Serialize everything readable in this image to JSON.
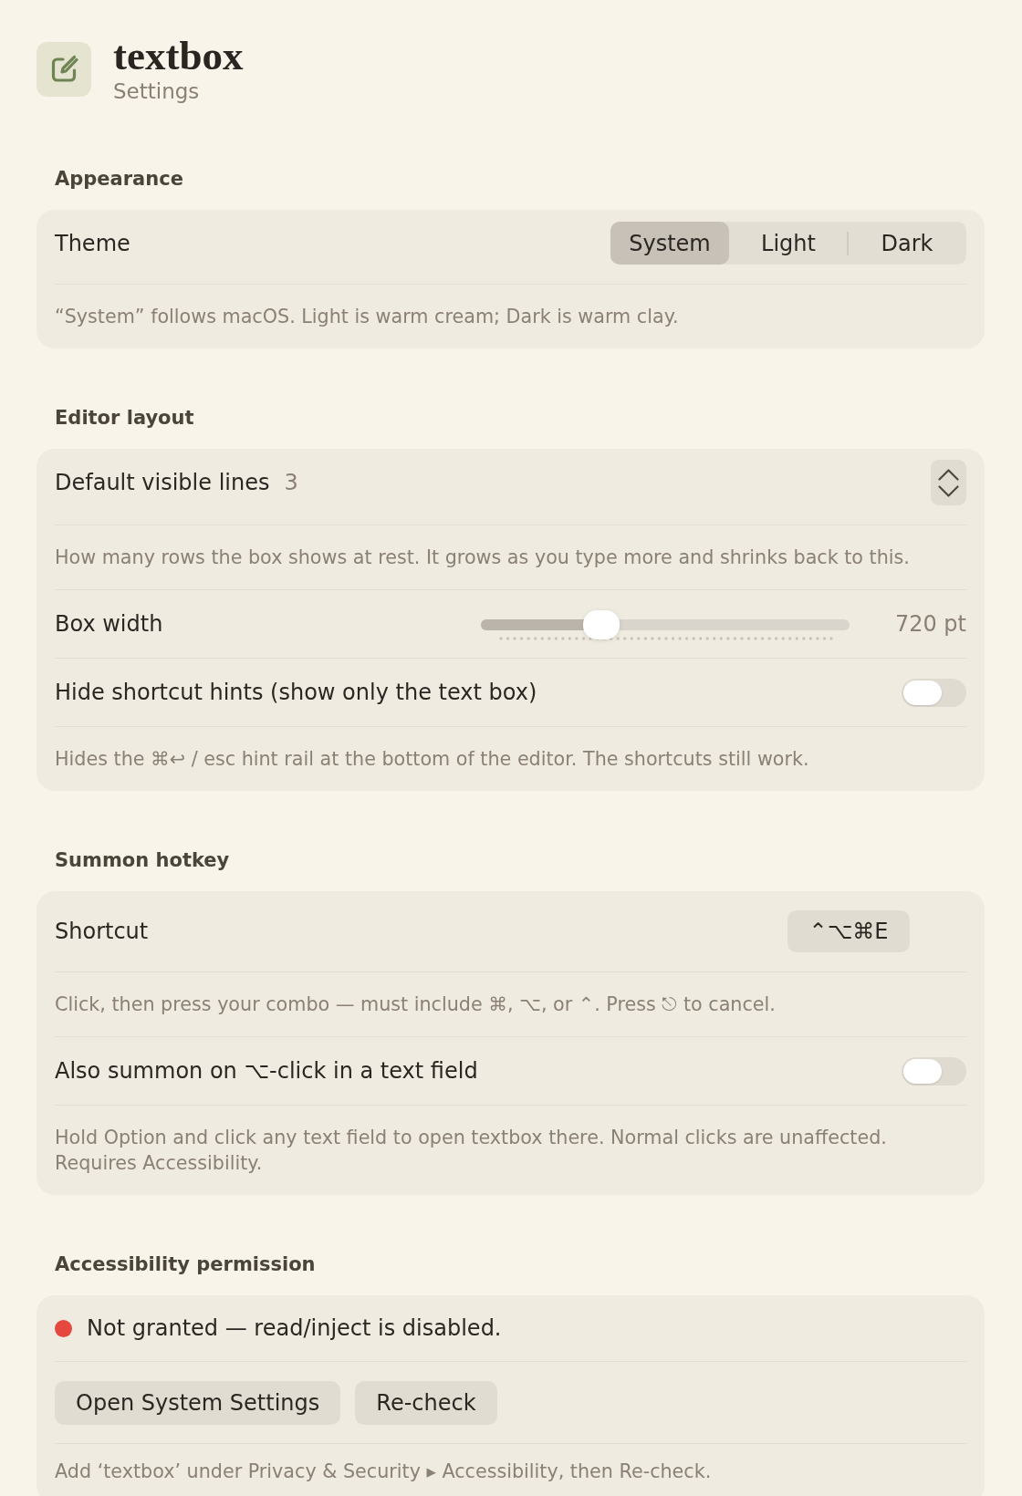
{
  "app": {
    "title": "textbox",
    "subtitle": "Settings"
  },
  "sections": [
    {
      "heading": "Appearance",
      "rows": [
        {
          "kind": "segmented",
          "label": "Theme",
          "options": [
            {
              "label": "System",
              "selected": true
            },
            {
              "label": "Light",
              "selected": false
            },
            {
              "label": "Dark",
              "selected": false
            }
          ]
        },
        {
          "kind": "note",
          "text": "“System” follows macOS. Light is warm cream; Dark is warm clay."
        }
      ]
    },
    {
      "heading": "Editor layout",
      "rows": [
        {
          "kind": "stepper",
          "label": "Default visible lines",
          "value": "3"
        },
        {
          "kind": "note",
          "text": "How many rows the box shows at rest. It grows as you type more and shrinks back to this."
        },
        {
          "kind": "slider",
          "label": "Box width",
          "level": 0.326,
          "reading": "720 pt"
        },
        {
          "kind": "toggle",
          "label": "Hide shortcut hints (show only the text box)",
          "on": false
        },
        {
          "kind": "note",
          "text": "Hides the ⌘↩ / esc hint rail at the bottom of the editor. The shortcuts still work."
        }
      ]
    },
    {
      "heading": "Summon hotkey",
      "rows": [
        {
          "kind": "shortcut",
          "label": "Shortcut",
          "keys": "⌃⌥⌘E"
        },
        {
          "kind": "note",
          "text": "Click, then press your combo — must include ⌘, ⌥, or ⌃. Press ⎋ to cancel."
        },
        {
          "kind": "toggle",
          "label": "Also summon on ⌥-click in a text field",
          "on": false
        },
        {
          "kind": "note",
          "text": "Hold Option and click any text field to open textbox there. Normal clicks are unaffected. Requires Accessibility."
        }
      ]
    },
    {
      "heading": "Accessibility permission",
      "rows": [
        {
          "kind": "status",
          "text": "Not granted — read/inject is disabled.",
          "color": "#e5483f"
        },
        {
          "kind": "buttons",
          "buttons": [
            "Open System Settings",
            "Re-check"
          ]
        },
        {
          "kind": "note",
          "text": "Add ‘textbox’ under Privacy & Security ▸ Accessibility, then Re-check."
        }
      ]
    }
  ]
}
